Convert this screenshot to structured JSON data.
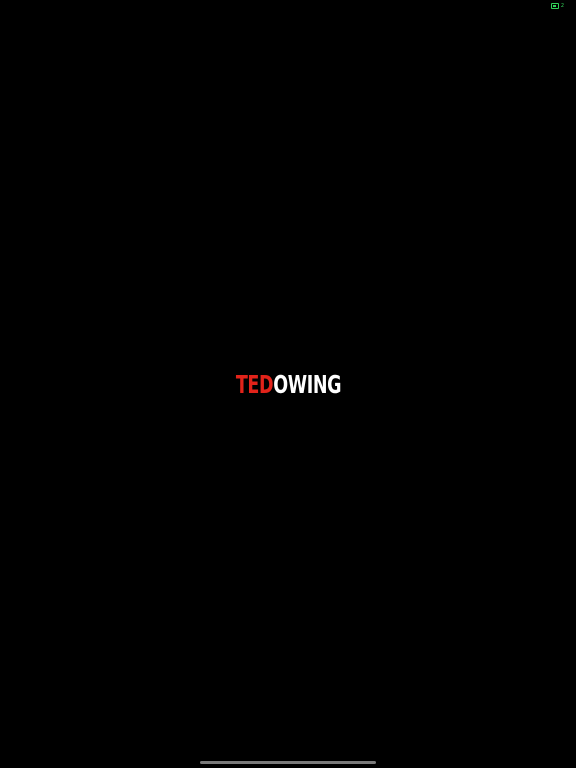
{
  "status_bar": {
    "battery_icon": "battery-icon",
    "battery_color": "#31d158",
    "battery_text": "2"
  },
  "splash": {
    "logo_part_1": "TED",
    "logo_part_2": "OWING",
    "logo_color_1": "#e2231a",
    "logo_color_2": "#ffffff",
    "background_color": "#000000"
  },
  "home_indicator": {
    "color": "#7a7a7a"
  }
}
